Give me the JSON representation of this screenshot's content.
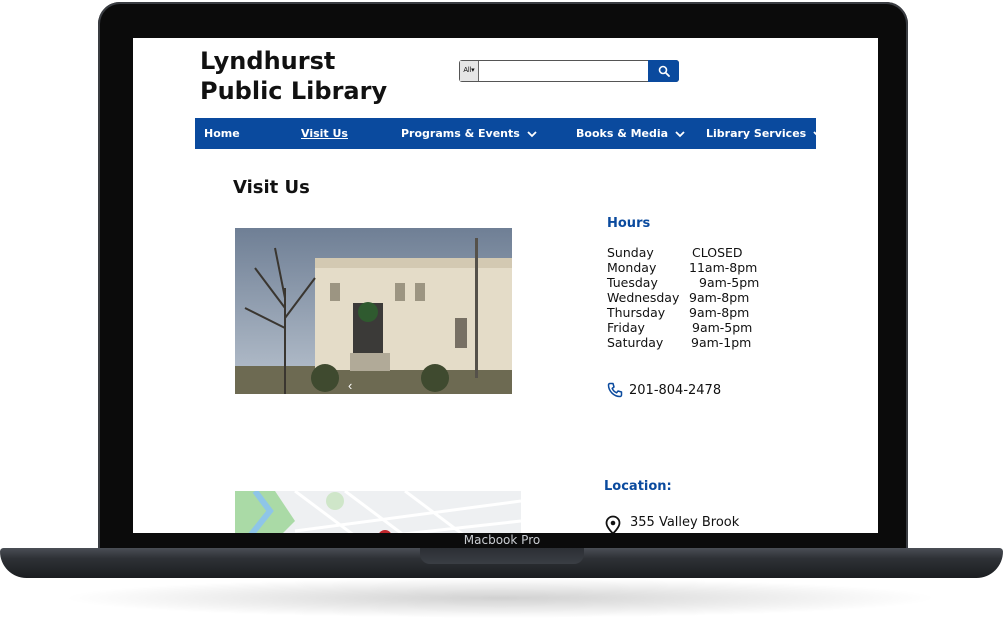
{
  "device": {
    "label": "Macbook Pro"
  },
  "site": {
    "title_line1": "Lyndhurst",
    "title_line2": "Public Library"
  },
  "search": {
    "scope": "All",
    "placeholder": "",
    "value": "",
    "icon": "search-icon"
  },
  "nav": {
    "items": [
      {
        "label": "Home",
        "active": false,
        "has_dropdown": false
      },
      {
        "label": "Visit Us",
        "active": true,
        "has_dropdown": false
      },
      {
        "label": "Programs & Events",
        "active": false,
        "has_dropdown": true
      },
      {
        "label": "Books & Media",
        "active": false,
        "has_dropdown": true
      },
      {
        "label": "Library Services",
        "active": false,
        "has_dropdown": true
      }
    ],
    "color": "#0a4a9e"
  },
  "main": {
    "page_title": "Visit Us",
    "hours_title": "Hours",
    "hours": [
      {
        "day": "Sunday",
        "time": "CLOSED"
      },
      {
        "day": "Monday",
        "time": "11am-8pm"
      },
      {
        "day": "Tuesday",
        "time": "9am-5pm"
      },
      {
        "day": "Wednesday",
        "time": "9am-8pm"
      },
      {
        "day": "Thursday",
        "time": "9am-8pm"
      },
      {
        "day": "Friday",
        "time": "9am-5pm"
      },
      {
        "day": "Saturday",
        "time": "9am-1pm"
      }
    ],
    "phone": "201-804-2478",
    "location_title": "Location:",
    "address_line1": "355 Valley Brook"
  }
}
